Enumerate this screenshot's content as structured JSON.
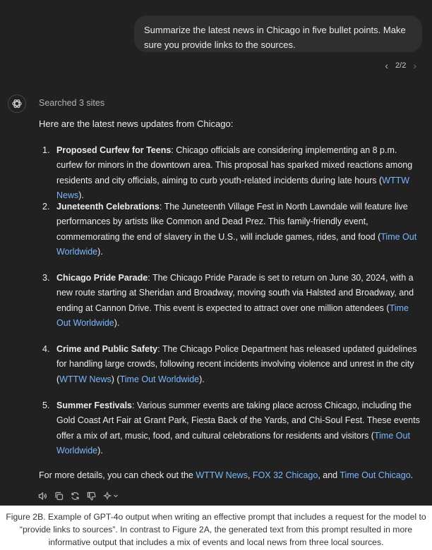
{
  "user_message": "Summarize the latest news in Chicago in five bullet points. Make sure you provide links to the sources.",
  "pager": {
    "label": "2/2"
  },
  "assistant": {
    "searched": "Searched 3 sites",
    "intro": "Here are the latest news updates from Chicago:",
    "items": [
      {
        "num": "1.",
        "heading": "Proposed Curfew for Teens",
        "text": ": Chicago officials are considering implementing an 8 p.m. curfew for minors in the downtown area. This proposal has sparked mixed reactions among residents and city officials, aiming to curb youth-related incidents during late hours (",
        "link": "WTTW News",
        "tail": ")."
      },
      {
        "num": "2.",
        "heading": "Juneteenth Celebrations",
        "text": ": The Juneteenth Village Fest in North Lawndale will feature live performances by artists like Common and Dead Prez. This family-friendly event, commemorating the end of slavery in the U.S., will include games, rides, and food (",
        "link": "Time Out Worldwide",
        "tail": ")."
      },
      {
        "num": "3.",
        "heading": "Chicago Pride Parade",
        "text": ": The Chicago Pride Parade is set to return on June 30, 2024, with a new route starting at Sheridan and Broadway, moving south via Halsted and Broadway, and ending at Cannon Drive. This event is expected to attract over one million attendees (",
        "link": "Time Out Worldwide",
        "tail": ")."
      },
      {
        "num": "4.",
        "heading": "Crime and Public Safety",
        "text": ": The Chicago Police Department has released updated guidelines for handling large crowds, following recent incidents involving violence and unrest in the city (",
        "link": "WTTW News",
        "mid": ") (",
        "link2": "Time Out Worldwide",
        "tail": ")."
      },
      {
        "num": "5.",
        "heading": "Summer Festivals",
        "text": ": Various summer events are taking place across Chicago, including the Gold Coast Art Fair at Grant Park, Fiesta Back of the Yards, and Chi-Soul Fest. These events offer a mix of art, music, food, and cultural celebrations for residents and visitors (",
        "link": "Time Out Worldwide",
        "tail": ")."
      }
    ],
    "footer": {
      "prefix": "For more details, you can check out the ",
      "link1": "WTTW News",
      "sep1": ", ",
      "link2": "FOX 32 Chicago",
      "sep2": ", and ",
      "link3": "Time Out Chicago",
      "end": "."
    },
    "actions": [
      "speaker-icon",
      "copy-icon",
      "regenerate-icon",
      "thumbs-down-icon",
      "sparkle-model-icon"
    ]
  },
  "caption": "Figure 2B. Example of GPT-4o output when writing an effective prompt that includes a request for the model to “provide links to sources”. In contrast to Figure 2A, the generated text from this prompt resulted in more informative output that includes a mix of events and local news from three local sources."
}
